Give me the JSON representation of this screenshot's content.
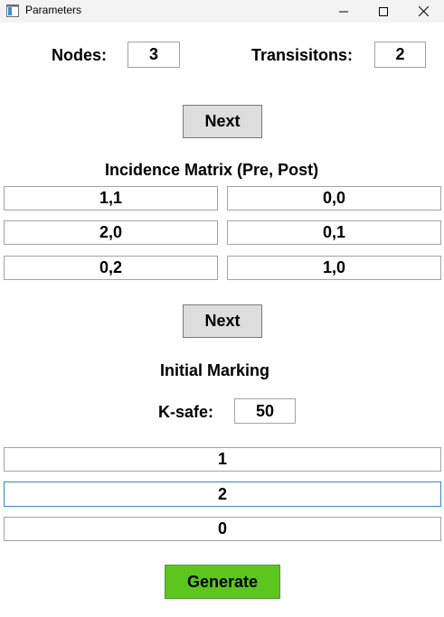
{
  "window": {
    "title": "Parameters",
    "app_icon": "window-app-icon",
    "controls": {
      "minimize_icon": "minimize-icon",
      "maximize_icon": "maximize-icon",
      "close_icon": "close-icon"
    }
  },
  "params": {
    "nodes_label": "Nodes:",
    "nodes_value": "3",
    "transitions_label": "Transisitons:",
    "transitions_value": "2"
  },
  "next_button_1": "Next",
  "incidence": {
    "title": "Incidence Matrix (Pre, Post)",
    "rows": [
      {
        "pre": "1,1",
        "post": "0,0"
      },
      {
        "pre": "2,0",
        "post": "0,1"
      },
      {
        "pre": "0,2",
        "post": "1,0"
      }
    ]
  },
  "next_button_2": "Next",
  "marking": {
    "title": "Initial Marking",
    "ksafe_label": "K-safe:",
    "ksafe_value": "50",
    "values": [
      "1",
      "2",
      "0"
    ]
  },
  "generate_button": "Generate",
  "colors": {
    "generate": "#5cc61e",
    "button": "#dddddd",
    "focus_border": "#3c86c8"
  }
}
